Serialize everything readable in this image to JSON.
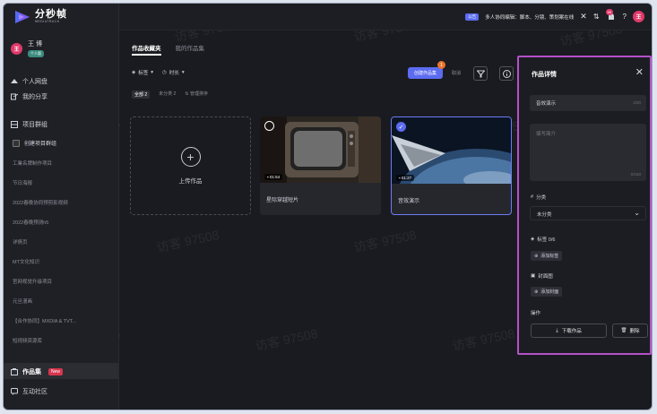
{
  "app": {
    "logo_cn": "分秒帧",
    "logo_en": "MEDIATRACK",
    "watermark": "访客 97508"
  },
  "topbar": {
    "collab_badge": "公告",
    "collab_text": "多人协同编辑：脚本、分镜、策划案在线",
    "close_glyph": "✕",
    "sort_glyph": "⇅",
    "notif_count": "99",
    "help_glyph": "?",
    "avatar_initial": "王"
  },
  "user": {
    "initial": "王",
    "name": "王 博",
    "badge": "个人版"
  },
  "sidebar": {
    "personal_disk": "个人网盘",
    "my_share": "我的分享",
    "project_group": "项目群组",
    "create_group": "创建项目群组",
    "groups": [
      "工業名牌制作项目",
      "节日海报",
      "2022春晚协同预剪影视频",
      "2022春晚预测h5",
      "详情页",
      "MT文化知识",
      "官网视觉升级项目",
      "元旦漫画",
      "【合作协同】MXDIA & TVT...",
      "短视频资源库"
    ],
    "collections": "作品集",
    "new_badge": "New",
    "community": "互动社区"
  },
  "tabs": {
    "collection": "作品收藏夹",
    "my_collections": "我的作品集"
  },
  "filters": {
    "tag": "标签",
    "time": "时长",
    "all": "全部 2",
    "unclassified": "未分类 2",
    "manage_sort": "管理排序"
  },
  "toolbar": {
    "create": "创建作品集",
    "create_count": "1",
    "cancel": "取消"
  },
  "upload": {
    "label": "上传作品"
  },
  "cards": [
    {
      "title": "星际穿越短片",
      "duration": "01:54",
      "selected": false
    },
    {
      "title": "音效演示",
      "duration": "01:27",
      "selected": true
    }
  ],
  "panel": {
    "title": "作品详情",
    "name_value": "音效演示",
    "name_counter": "4/30",
    "intro_placeholder": "填写简介",
    "intro_counter": "0/150",
    "category_label": "分类",
    "category_value": "未分类",
    "tag_label": "标签 0/6",
    "add_tag": "添加标签",
    "cover_label": "封面图",
    "add_cover": "添加封面",
    "ops_label": "操作",
    "download": "下载作品",
    "delete": "删除"
  }
}
